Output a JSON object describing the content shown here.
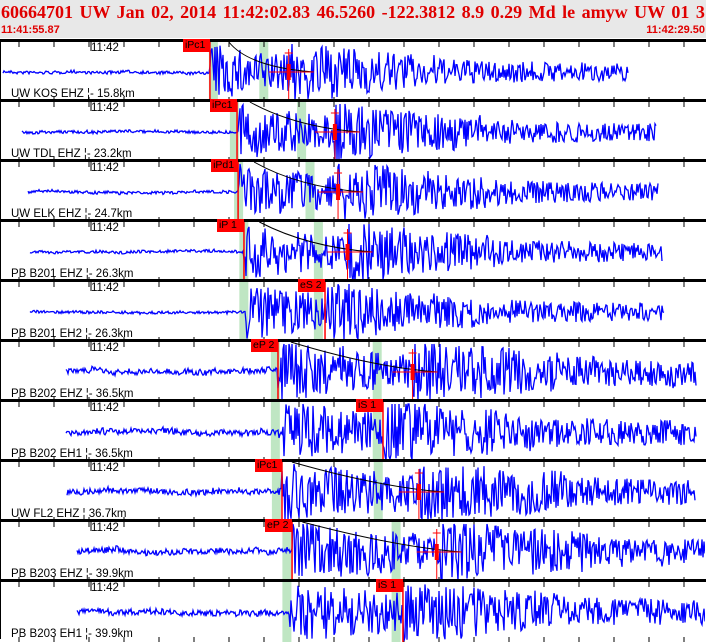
{
  "header": {
    "title": "60664701 UW Jan 02, 2014 11:42:02.83    46.5260 -122.3812  8.9 0.29 Md le amyw UW 01    3",
    "start_time": "11:41:55.87",
    "end_time": "11:42:29.50"
  },
  "colors": {
    "trace": "#0000ff",
    "pick": "#ff0000",
    "window": "#bfe6c3",
    "header_bg": "#e8e8e8",
    "title": "#e00000"
  },
  "traces": [
    {
      "label": "UW KOS EHZ ¦- 15.8km",
      "time_label": "11:42",
      "pick": "iPc1",
      "pick_s": 9.95,
      "s_s": 13.7,
      "windows_s": [
        9.9,
        12.3
      ],
      "span_s": [
        0.1,
        29.9
      ],
      "z": true
    },
    {
      "label": "UW TDL EHZ ¦- 23.2km",
      "time_label": "11:42",
      "pick": "iPc1",
      "pick_s": 11.24,
      "s_s": 15.9,
      "windows_s": [
        10.9,
        14.1
      ],
      "span_s": [
        1.0,
        31.2
      ],
      "z": true
    },
    {
      "label": "UW ELK EHZ ¦- 24.7km",
      "time_label": "11:42",
      "pick": "iPd1",
      "pick_s": 11.29,
      "s_s": 16.05,
      "windows_s": [
        11.1,
        14.5
      ],
      "span_s": [
        1.3,
        31.3
      ],
      "z": true
    },
    {
      "label": "PB B201 EHZ ¦- 26.3km",
      "time_label": "11:42",
      "pick": "iP 1",
      "pick_s": 11.57,
      "s_s": 16.5,
      "windows_s": [
        11.35,
        14.9
      ],
      "span_s": [
        1.4,
        31.5
      ],
      "z": true
    },
    {
      "label": "PB B201 EH2 ¦- 26.3km",
      "time_label": "11:42",
      "pick": "eS 2",
      "pick_s": 15.43,
      "s_s": null,
      "windows_s": [
        11.35,
        14.9
      ],
      "span_s": [
        1.4,
        31.6
      ],
      "z": false
    },
    {
      "label": "PB B202 EHZ ¦- 36.5km",
      "time_label": "11:42",
      "pick": "eP 2",
      "pick_s": 13.19,
      "s_s": 19.6,
      "windows_s": [
        12.85,
        17.7
      ],
      "span_s": [
        3.1,
        33.1
      ],
      "z": true
    },
    {
      "label": "PB B202 EH1 ¦- 36.5km",
      "time_label": "11:42",
      "pick": "iS 1",
      "pick_s": 18.19,
      "s_s": null,
      "windows_s": [
        12.85,
        17.7
      ],
      "span_s": [
        3.1,
        33.1
      ],
      "z": false
    },
    {
      "label": "UW FL2 EHZ ¦ 36.7km",
      "time_label": "11:42",
      "pick": "iPc1",
      "pick_s": 13.38,
      "s_s": 19.9,
      "windows_s": [
        12.9,
        17.75
      ],
      "span_s": [
        3.15,
        33.1
      ],
      "z": true
    },
    {
      "label": "PB B203 EHZ ¦- 39.9km",
      "time_label": "11:42",
      "pick": "eP 2",
      "pick_s": 13.86,
      "s_s": 20.75,
      "windows_s": [
        13.4,
        18.6
      ],
      "span_s": [
        3.6,
        33.6
      ],
      "z": true
    },
    {
      "label": "PB B203 EH1 ¦- 39.9km",
      "time_label": "11:42",
      "pick": "iS 1",
      "pick_s": 19.14,
      "s_s": null,
      "windows_s": [
        13.4,
        18.6
      ],
      "span_s": [
        3.6,
        33.6
      ],
      "z": false
    }
  ]
}
